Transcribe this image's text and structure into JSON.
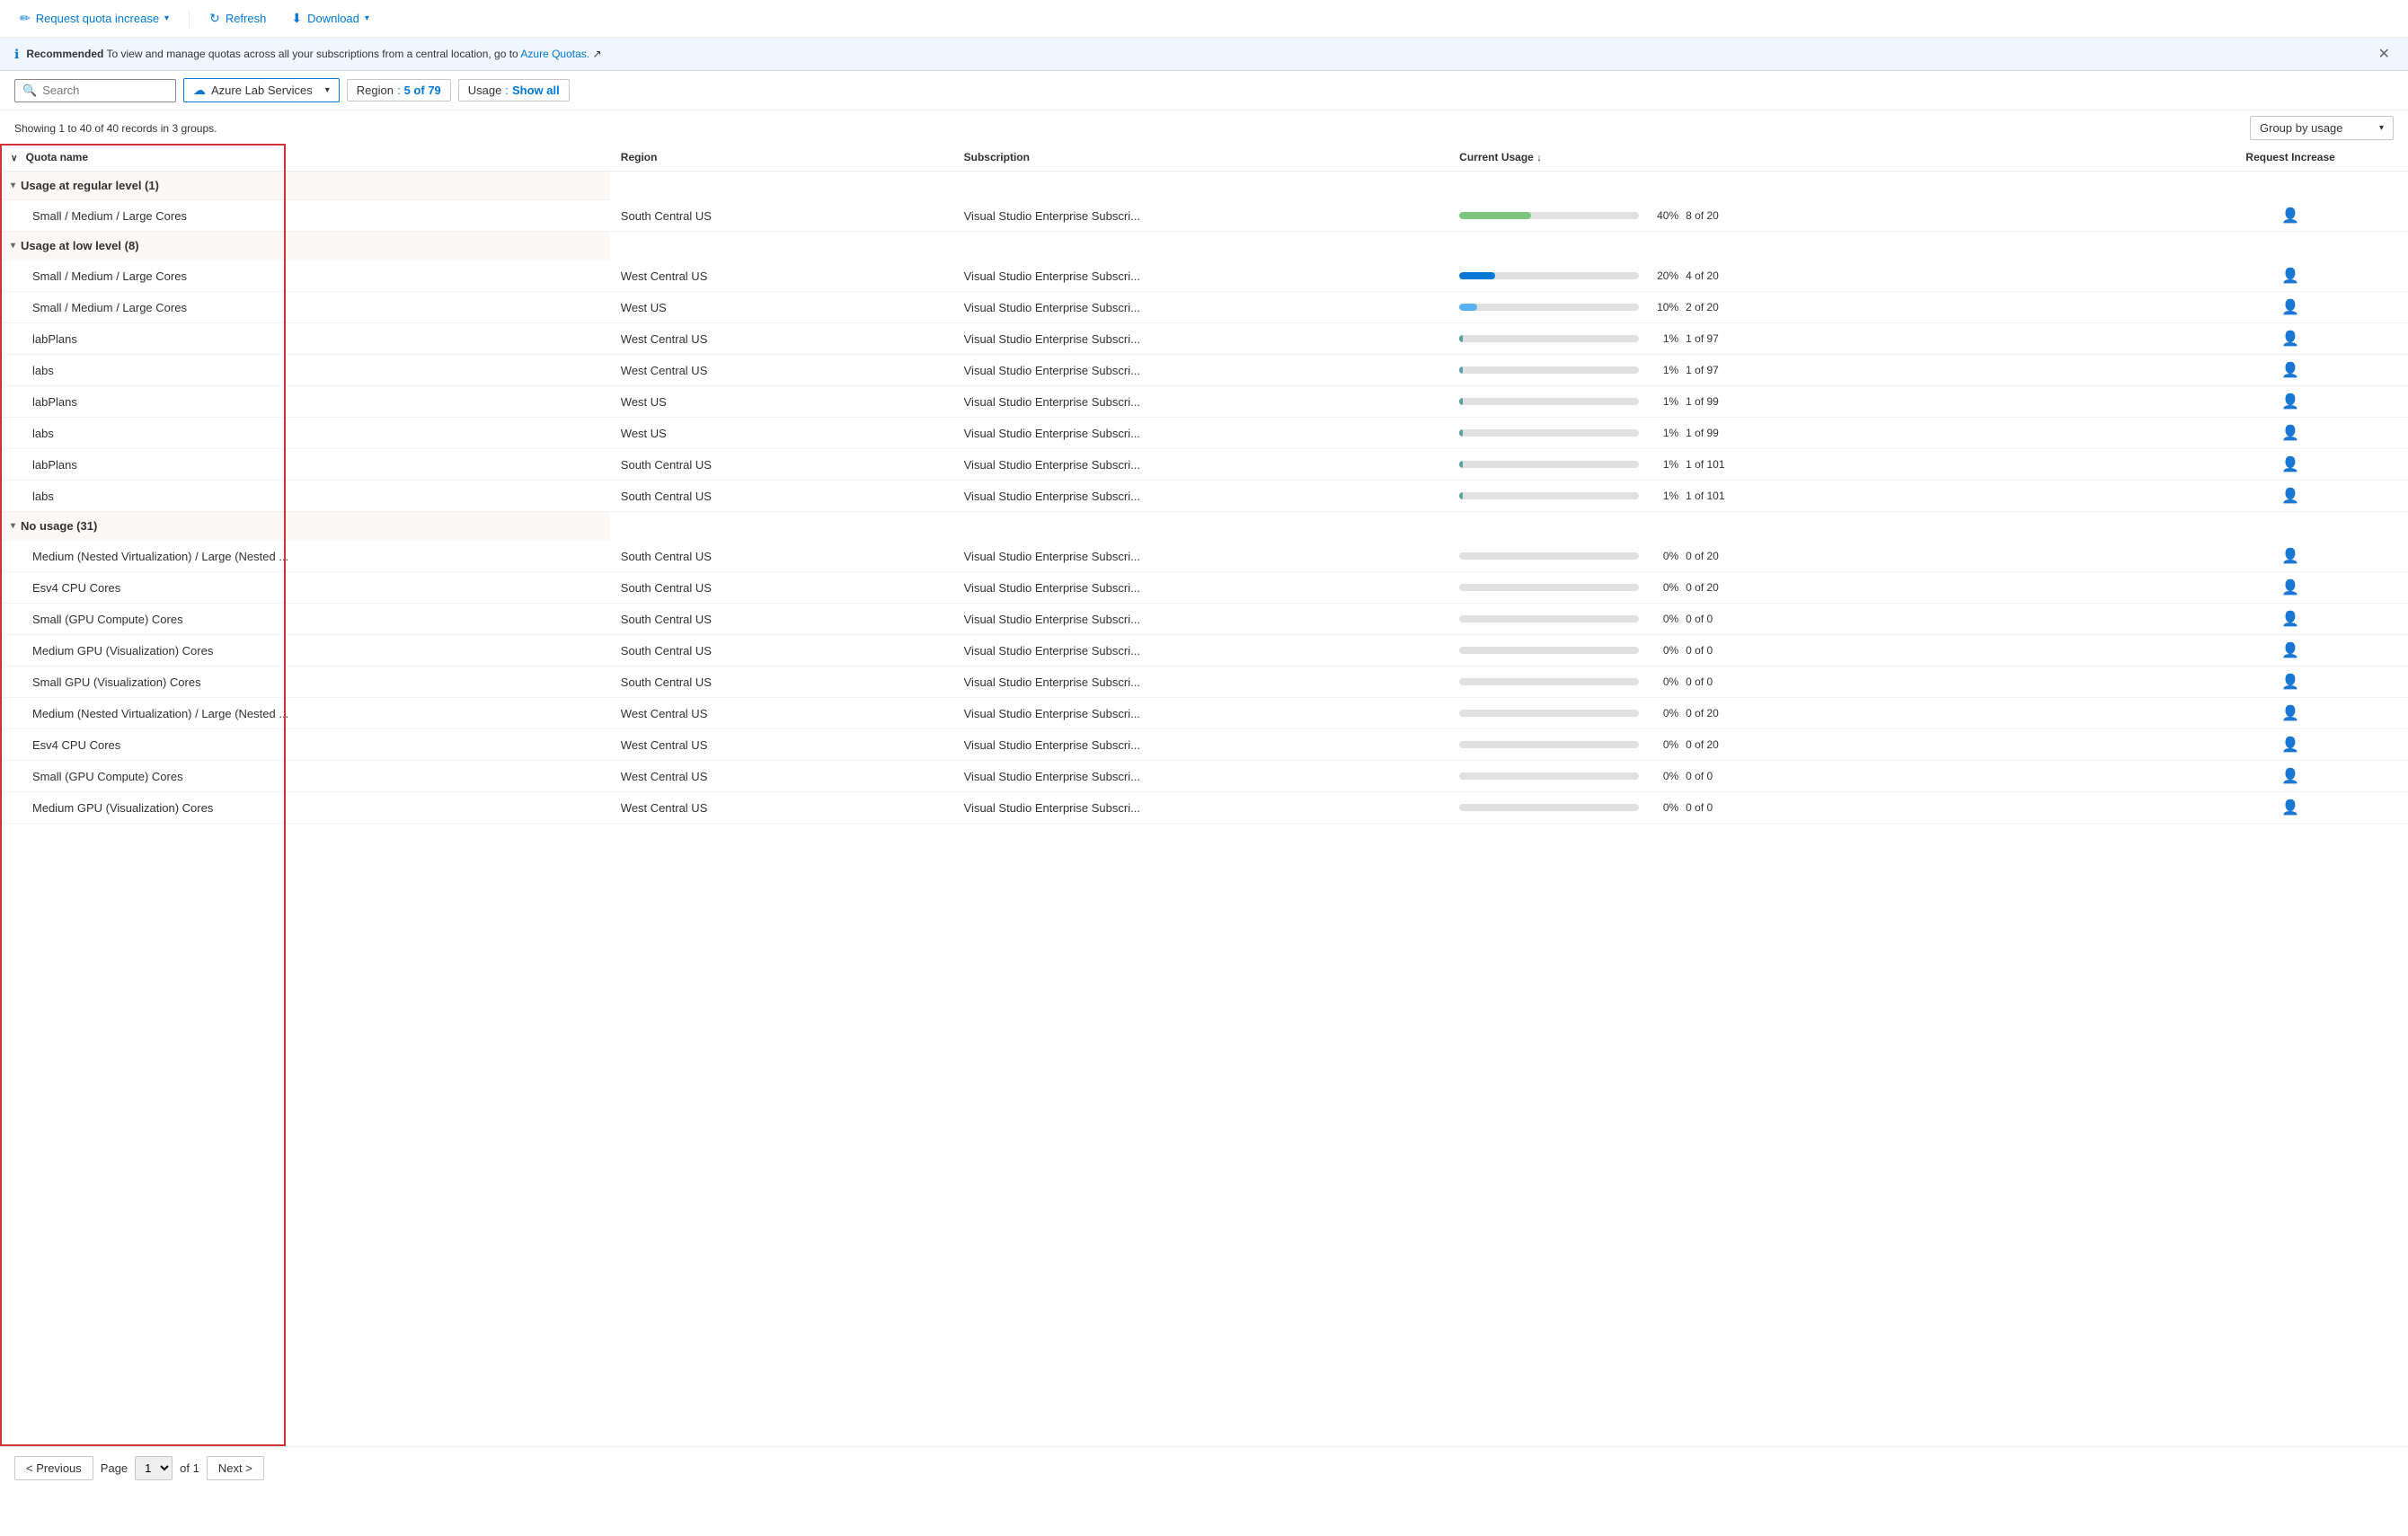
{
  "toolbar": {
    "request_quota_label": "Request quota increase",
    "refresh_label": "Refresh",
    "download_label": "Download"
  },
  "banner": {
    "badge": "Recommended",
    "text": " To view and manage quotas across all your subscriptions from a central location, go to ",
    "link_label": "Azure Quotas.",
    "external_icon": "↗"
  },
  "filters": {
    "search_placeholder": "Search",
    "service_label": "Azure Lab Services",
    "region_label": "Region",
    "region_value": "5 of 79",
    "usage_label": "Usage",
    "usage_value": "Show all"
  },
  "summary": {
    "text": "Showing 1 to 40 of 40 records in 3 groups.",
    "group_by_label": "Group by usage"
  },
  "columns": {
    "quota_name": "Quota name",
    "region": "Region",
    "subscription": "Subscription",
    "current_usage": "Current Usage",
    "request_increase": "Request Increase"
  },
  "groups": [
    {
      "id": "regular",
      "label": "Usage at regular level (1)",
      "expanded": true,
      "rows": [
        {
          "quota": "Small / Medium / Large Cores",
          "region": "South Central US",
          "subscription": "Visual Studio Enterprise Subscri...",
          "pct": 40,
          "fraction": "8 of 20",
          "bar_class": "green"
        }
      ]
    },
    {
      "id": "low",
      "label": "Usage at low level (8)",
      "expanded": true,
      "rows": [
        {
          "quota": "Small / Medium / Large Cores",
          "region": "West Central US",
          "subscription": "Visual Studio Enterprise Subscri...",
          "pct": 20,
          "fraction": "4 of 20",
          "bar_class": "blue-dark"
        },
        {
          "quota": "Small / Medium / Large Cores",
          "region": "West US",
          "subscription": "Visual Studio Enterprise Subscri...",
          "pct": 10,
          "fraction": "2 of 20",
          "bar_class": "blue-light"
        },
        {
          "quota": "labPlans",
          "region": "West Central US",
          "subscription": "Visual Studio Enterprise Subscri...",
          "pct": 1,
          "fraction": "1 of 97",
          "bar_class": "teal"
        },
        {
          "quota": "labs",
          "region": "West Central US",
          "subscription": "Visual Studio Enterprise Subscri...",
          "pct": 1,
          "fraction": "1 of 97",
          "bar_class": "teal"
        },
        {
          "quota": "labPlans",
          "region": "West US",
          "subscription": "Visual Studio Enterprise Subscri...",
          "pct": 1,
          "fraction": "1 of 99",
          "bar_class": "teal"
        },
        {
          "quota": "labs",
          "region": "West US",
          "subscription": "Visual Studio Enterprise Subscri...",
          "pct": 1,
          "fraction": "1 of 99",
          "bar_class": "teal"
        },
        {
          "quota": "labPlans",
          "region": "South Central US",
          "subscription": "Visual Studio Enterprise Subscri...",
          "pct": 1,
          "fraction": "1 of 101",
          "bar_class": "teal"
        },
        {
          "quota": "labs",
          "region": "South Central US",
          "subscription": "Visual Studio Enterprise Subscri...",
          "pct": 1,
          "fraction": "1 of 101",
          "bar_class": "teal"
        }
      ]
    },
    {
      "id": "none",
      "label": "No usage (31)",
      "expanded": true,
      "rows": [
        {
          "quota": "Medium (Nested Virtualization) / Large (Nested ...",
          "region": "South Central US",
          "subscription": "Visual Studio Enterprise Subscri...",
          "pct": 0,
          "fraction": "0 of 20",
          "bar_class": "gray"
        },
        {
          "quota": "Esv4 CPU Cores",
          "region": "South Central US",
          "subscription": "Visual Studio Enterprise Subscri...",
          "pct": 0,
          "fraction": "0 of 20",
          "bar_class": "gray"
        },
        {
          "quota": "Small (GPU Compute) Cores",
          "region": "South Central US",
          "subscription": "Visual Studio Enterprise Subscri...",
          "pct": 0,
          "fraction": "0 of 0",
          "bar_class": "gray"
        },
        {
          "quota": "Medium GPU (Visualization) Cores",
          "region": "South Central US",
          "subscription": "Visual Studio Enterprise Subscri...",
          "pct": 0,
          "fraction": "0 of 0",
          "bar_class": "gray"
        },
        {
          "quota": "Small GPU (Visualization) Cores",
          "region": "South Central US",
          "subscription": "Visual Studio Enterprise Subscri...",
          "pct": 0,
          "fraction": "0 of 0",
          "bar_class": "gray"
        },
        {
          "quota": "Medium (Nested Virtualization) / Large (Nested ...",
          "region": "West Central US",
          "subscription": "Visual Studio Enterprise Subscri...",
          "pct": 0,
          "fraction": "0 of 20",
          "bar_class": "gray"
        },
        {
          "quota": "Esv4 CPU Cores",
          "region": "West Central US",
          "subscription": "Visual Studio Enterprise Subscri...",
          "pct": 0,
          "fraction": "0 of 20",
          "bar_class": "gray"
        },
        {
          "quota": "Small (GPU Compute) Cores",
          "region": "West Central US",
          "subscription": "Visual Studio Enterprise Subscri...",
          "pct": 0,
          "fraction": "0 of 0",
          "bar_class": "gray"
        },
        {
          "quota": "Medium GPU (Visualization) Cores",
          "region": "West Central US",
          "subscription": "Visual Studio Enterprise Subscri...",
          "pct": 0,
          "fraction": "0 of 0",
          "bar_class": "gray"
        }
      ]
    }
  ],
  "pagination": {
    "prev_label": "< Previous",
    "next_label": "Next >",
    "page_label": "Page",
    "page_value": "1",
    "of_label": "of 1"
  }
}
